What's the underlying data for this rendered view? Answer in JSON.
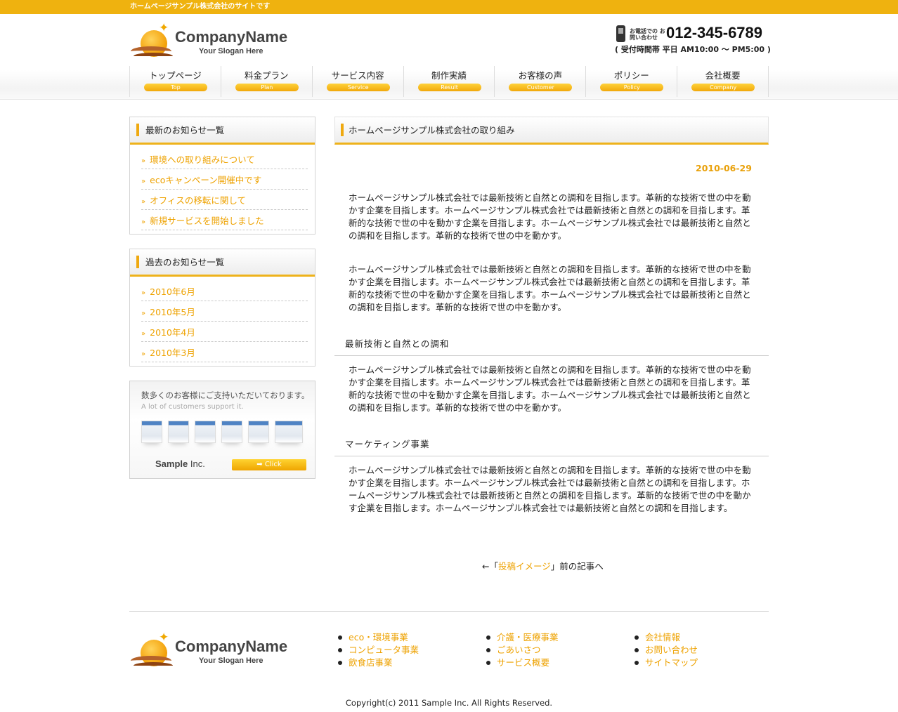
{
  "topbar": {
    "text": "ホームページサンプル株式会社のサイトです"
  },
  "header": {
    "company_name": "CompanyName",
    "slogan": "Your Slogan Here",
    "phone_label": "お電話での お問い合わせ",
    "phone_number": "012-345-6789",
    "hours": "( 受付時間帯 平日 AM10:00 〜 PM5:00 )"
  },
  "nav": [
    {
      "jp": "トップページ",
      "en": "Top"
    },
    {
      "jp": "料金プラン",
      "en": "Plan"
    },
    {
      "jp": "サービス内容",
      "en": "Service"
    },
    {
      "jp": "制作実績",
      "en": "Result"
    },
    {
      "jp": "お客様の声",
      "en": "Customer"
    },
    {
      "jp": "ポリシー",
      "en": "Policy"
    },
    {
      "jp": "会社概要",
      "en": "Company"
    }
  ],
  "sidebar": {
    "latest": {
      "title": "最新のお知らせ一覧",
      "items": [
        "環境への取り組みについて",
        "ecoキャンペーン開催中です",
        "オフィスの移転に関して",
        "新規サービスを開始しました"
      ]
    },
    "past": {
      "title": "過去のお知らせ一覧",
      "items": [
        "2010年6月",
        "2010年5月",
        "2010年4月",
        "2010年3月"
      ]
    },
    "banner": {
      "jp": "数多くのお客様にご支持いただいております。",
      "en": "A lot of customers support it.",
      "company_bold": "Sample",
      "company_rest": " Inc.",
      "click": "➡ Click"
    },
    "marker": "»"
  },
  "main": {
    "title": "ホームページサンプル株式会社の取り組み",
    "date": "2010-06-29",
    "para1": "ホームページサンプル株式会社では最新技術と自然との調和を目指します。革新的な技術で世の中を動かす企業を目指します。ホームページサンプル株式会社では最新技術と自然との調和を目指します。革新的な技術で世の中を動かす企業を目指します。ホームページサンプル株式会社では最新技術と自然との調和を目指します。革新的な技術で世の中を動かす。",
    "para2": "ホームページサンプル株式会社では最新技術と自然との調和を目指します。革新的な技術で世の中を動かす企業を目指します。ホームページサンプル株式会社では最新技術と自然との調和を目指します。革新的な技術で世の中を動かす企業を目指します。ホームページサンプル株式会社では最新技術と自然との調和を目指します。革新的な技術で世の中を動かす。",
    "sub1": "最新技術と自然との調和",
    "para3": "ホームページサンプル株式会社では最新技術と自然との調和を目指します。革新的な技術で世の中を動かす企業を目指します。ホームページサンプル株式会社では最新技術と自然との調和を目指します。革新的な技術で世の中を動かす企業を目指します。ホームページサンプル株式会社では最新技術と自然との調和を目指します。革新的な技術で世の中を動かす。",
    "sub2": "マーケティング事業",
    "para4": "ホームページサンプル株式会社では最新技術と自然との調和を目指します。革新的な技術で世の中を動かす企業を目指します。ホームページサンプル株式会社では最新技術と自然との調和を目指します。ホームページサンプル株式会社では最新技術と自然との調和を目指します。革新的な技術で世の中を動かす企業を目指します。ホームページサンプル株式会社では最新技術と自然との調和を目指します。",
    "prev": {
      "before": "←「",
      "link": "投稿イメージ",
      "after": "」前の記事へ"
    }
  },
  "footer": {
    "company_name": "CompanyName",
    "slogan": "Your Slogan Here",
    "col1": [
      "eco・環境事業",
      "コンピュータ事業",
      "飲食店事業"
    ],
    "col2": [
      "介護・医療事業",
      "ごあいさつ",
      "サービス概要"
    ],
    "col3": [
      "会社情報",
      "お問い合わせ",
      "サイトマップ"
    ],
    "copyright": "Copyright(c) 2011 Sample Inc. All Rights Reserved."
  },
  "colors": {
    "accent": "#efb20f",
    "link": "#eea200"
  }
}
